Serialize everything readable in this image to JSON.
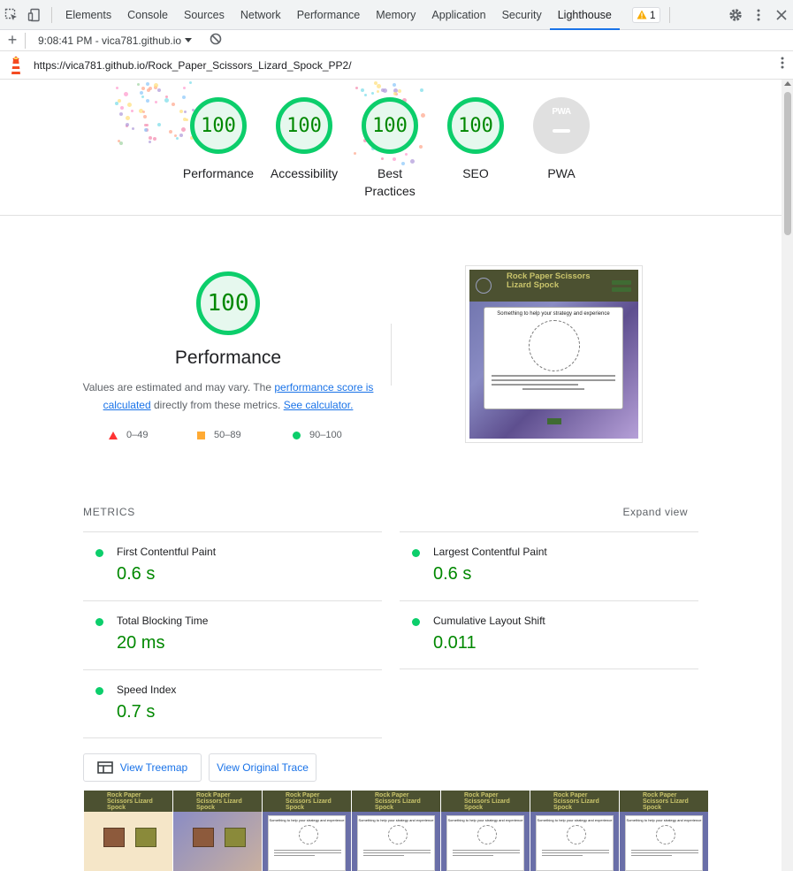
{
  "devtools": {
    "tabs": [
      "Elements",
      "Console",
      "Sources",
      "Network",
      "Performance",
      "Memory",
      "Application",
      "Security",
      "Lighthouse"
    ],
    "active_tab": "Lighthouse",
    "warning_count": "1"
  },
  "toolbar": {
    "report_label": "9:08:41 PM - vica781.github.io"
  },
  "url": "https://vica781.github.io/Rock_Paper_Scissors_Lizard_Spock_PP2/",
  "summary": {
    "gauges": [
      {
        "score": "100",
        "label": "Performance"
      },
      {
        "score": "100",
        "label": "Accessibility"
      },
      {
        "score": "100",
        "label": "Best Practices"
      },
      {
        "score": "100",
        "label": "SEO"
      }
    ],
    "pwa": {
      "badge": "PWA",
      "label": "PWA"
    }
  },
  "performance": {
    "score": "100",
    "title": "Performance",
    "desc_prefix": "Values are estimated and may vary. The ",
    "desc_link1": "performance score is calculated",
    "desc_middle": " directly from these metrics. ",
    "desc_link2": "See calculator.",
    "legend": {
      "fail": "0–49",
      "average": "50–89",
      "pass": "90–100"
    },
    "colors": {
      "pass": "#0cce6b",
      "average": "#ffaa33",
      "fail": "#ff3333",
      "pass_text": "#008800"
    }
  },
  "screenshot": {
    "title": "Rock Paper Scissors Lizard Spock",
    "modal_title": "Something to help your strategy and experience"
  },
  "metrics": {
    "heading": "METRICS",
    "expand": "Expand view",
    "items": [
      {
        "name": "First Contentful Paint",
        "value": "0.6 s"
      },
      {
        "name": "Largest Contentful Paint",
        "value": "0.6 s"
      },
      {
        "name": "Total Blocking Time",
        "value": "20 ms"
      },
      {
        "name": "Cumulative Layout Shift",
        "value": "0.011"
      },
      {
        "name": "Speed Index",
        "value": "0.7 s"
      }
    ]
  },
  "buttons": {
    "treemap": "View Treemap",
    "trace": "View Original Trace"
  },
  "filmstrip": {
    "title": "Rock Paper Scissors Lizard Spock",
    "modal_title": "Something to help your strategy and experience"
  }
}
